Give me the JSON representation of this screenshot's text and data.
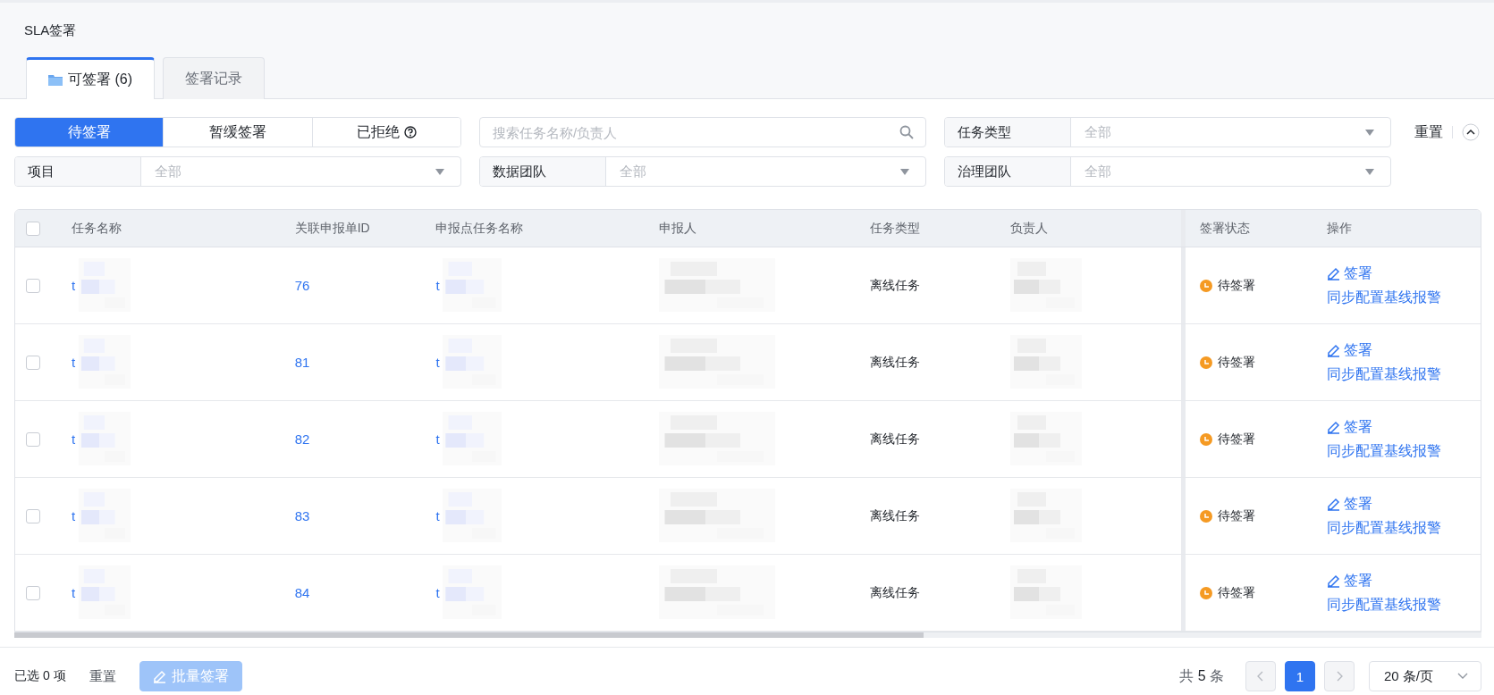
{
  "page": {
    "title": "SLA签署"
  },
  "tabs": [
    {
      "label": "可签署 (6)",
      "selected": true
    },
    {
      "label": "签署记录",
      "selected": false
    }
  ],
  "filters": {
    "status_segments": [
      {
        "label": "待签署",
        "selected": true
      },
      {
        "label": "暂缓签署",
        "selected": false
      },
      {
        "label": "已拒绝",
        "selected": false,
        "help": true
      }
    ],
    "search": {
      "placeholder": "搜索任务名称/负责人"
    },
    "selects": [
      {
        "label": "任务类型",
        "value": "全部"
      },
      {
        "label": "项目",
        "value": "全部"
      },
      {
        "label": "数据团队",
        "value": "全部"
      },
      {
        "label": "治理团队",
        "value": "全部"
      }
    ],
    "reset": "重置",
    "expanded": true
  },
  "table": {
    "columns": [
      "任务名称",
      "关联申报单ID",
      "申报点任务名称",
      "申报人",
      "任务类型",
      "负责人",
      "签署状态",
      "操作"
    ],
    "rows": [
      {
        "checked": false,
        "task_name": "t",
        "report_id": "76",
        "report_task_name": "t",
        "task_type": "离线任务",
        "status": "待签署",
        "actions": [
          "签署",
          "同步配置基线报警"
        ]
      },
      {
        "checked": false,
        "task_name": "t",
        "report_id": "81",
        "report_task_name": "t",
        "task_type": "离线任务",
        "status": "待签署",
        "actions": [
          "签署",
          "同步配置基线报警"
        ]
      },
      {
        "checked": false,
        "task_name": "t",
        "report_id": "82",
        "report_task_name": "t",
        "task_type": "离线任务",
        "status": "待签署",
        "actions": [
          "签署",
          "同步配置基线报警"
        ]
      },
      {
        "checked": false,
        "task_name": "t",
        "report_id": "83",
        "report_task_name": "t",
        "task_type": "离线任务",
        "status": "待签署",
        "actions": [
          "签署",
          "同步配置基线报警"
        ]
      },
      {
        "checked": false,
        "task_name": "t",
        "report_id": "84",
        "report_task_name": "t",
        "task_type": "离线任务",
        "status": "待签署",
        "actions": [
          "签署",
          "同步配置基线报警"
        ]
      }
    ],
    "select_all": false
  },
  "footer": {
    "selected_prefix": "已选",
    "selected_count": "0",
    "selected_suffix": "项",
    "reset": "重置",
    "batch_button": {
      "label": "批量签署",
      "disabled": true
    },
    "total_prefix": "共",
    "total": "5",
    "total_suffix": "条",
    "pages": [
      {
        "label": "1",
        "selected": true
      }
    ],
    "page_size": "20 条/页"
  }
}
